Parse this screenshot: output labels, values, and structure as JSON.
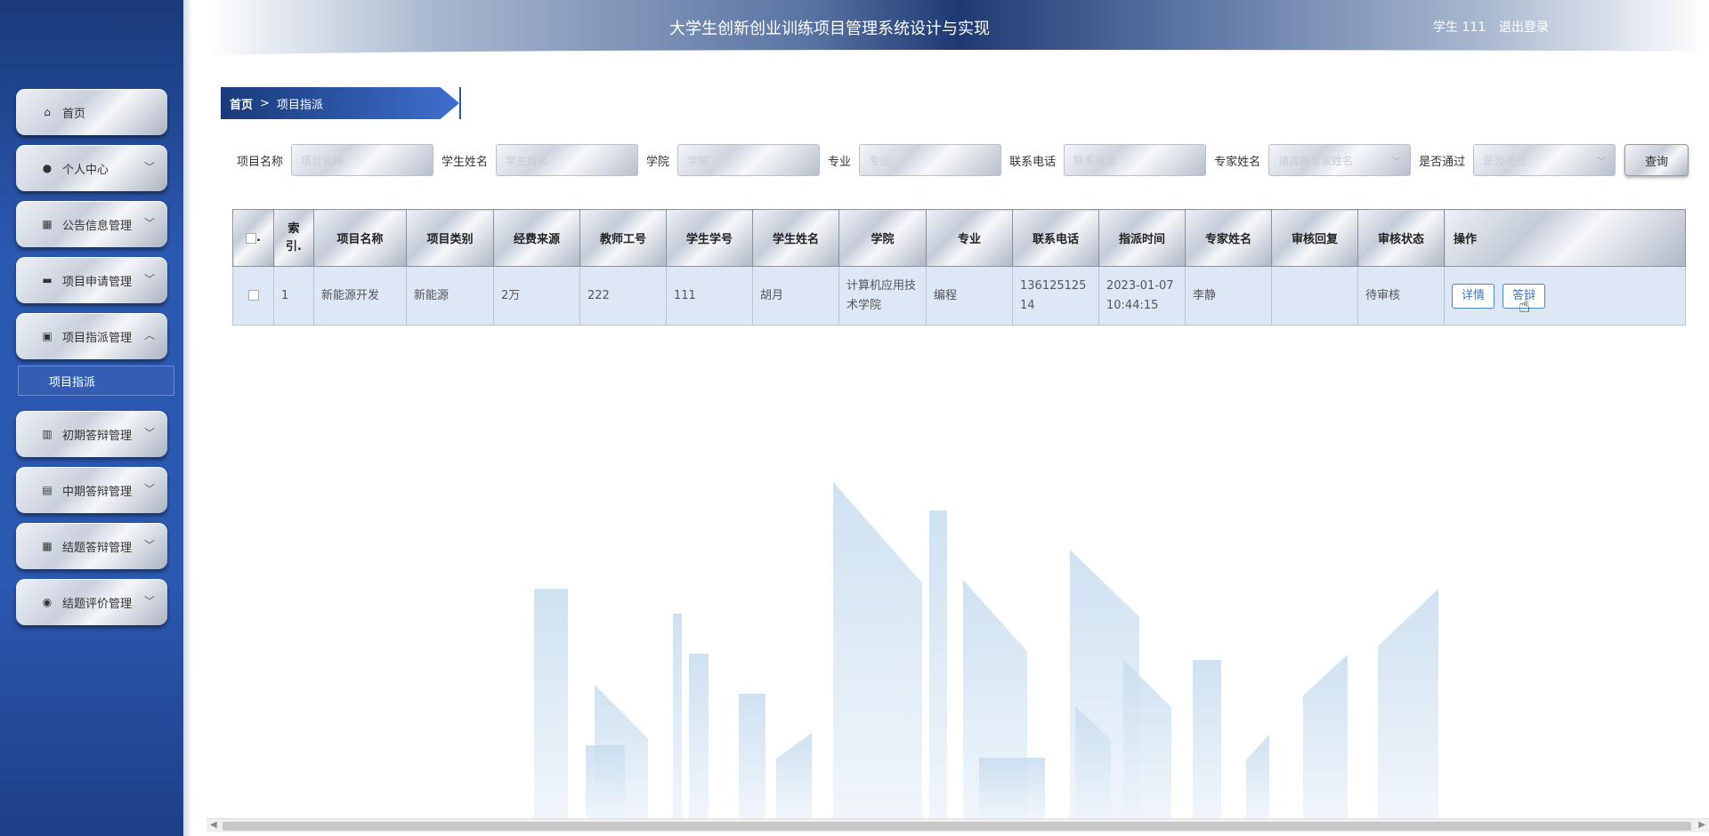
{
  "header": {
    "title": "大学生创新创业训练项目管理系统设计与实现",
    "user": "学生 111",
    "logout": "退出登录"
  },
  "sidebar": {
    "items": [
      {
        "label": "首页",
        "icon": "home-icon",
        "glyph": "⌂",
        "has_chevron": false
      },
      {
        "label": "个人中心",
        "icon": "user-icon",
        "glyph": "●",
        "has_chevron": true,
        "chevron": "﹀"
      },
      {
        "label": "公告信息管理",
        "icon": "grid-icon",
        "glyph": "▦",
        "has_chevron": true,
        "chevron": "﹀"
      },
      {
        "label": "项目申请管理",
        "icon": "briefcase-icon",
        "glyph": "▬",
        "has_chevron": true,
        "chevron": "﹀"
      },
      {
        "label": "项目指派管理",
        "icon": "clipboard-icon",
        "glyph": "▣",
        "has_chevron": true,
        "chevron": "︿"
      },
      {
        "label": "初期答辩管理",
        "icon": "bar-chart-icon",
        "glyph": "▥",
        "has_chevron": true,
        "chevron": "﹀"
      },
      {
        "label": "中期答辩管理",
        "icon": "book-icon",
        "glyph": "▤",
        "has_chevron": true,
        "chevron": "﹀"
      },
      {
        "label": "结题答辩管理",
        "icon": "grid-icon",
        "glyph": "▦",
        "has_chevron": true,
        "chevron": "﹀"
      },
      {
        "label": "结题评价管理",
        "icon": "location-icon",
        "glyph": "◉",
        "has_chevron": true,
        "chevron": "﹀"
      }
    ],
    "submenu": {
      "label": "项目指派"
    }
  },
  "breadcrumb": {
    "home": "首页",
    "separator": ">",
    "current": "项目指派"
  },
  "filters": {
    "project_name": {
      "label": "项目名称",
      "placeholder": "项目名称"
    },
    "student_name": {
      "label": "学生姓名",
      "placeholder": "学生姓名"
    },
    "college": {
      "label": "学院",
      "placeholder": "学院"
    },
    "major": {
      "label": "专业",
      "placeholder": "专业"
    },
    "phone": {
      "label": "联系电话",
      "placeholder": "联系电话"
    },
    "expert_name": {
      "label": "专家姓名",
      "placeholder": "请选择专家姓名"
    },
    "passed": {
      "label": "是否通过",
      "placeholder": "是否通过"
    },
    "search_label": "查询"
  },
  "table": {
    "checkbox_header_suffix": ".",
    "columns": [
      "索\n引.",
      "项目名称",
      "项目类别",
      "经费来源",
      "教师工号",
      "学生学号",
      "学生姓名",
      "学院",
      "专业",
      "联系电话",
      "指派时间",
      "专家姓名",
      "审核回复",
      "审核状态",
      "操作"
    ],
    "rows": [
      {
        "index": "1",
        "project_name": "新能源开发",
        "category": "新能源",
        "funding": "2万",
        "teacher_id": "222",
        "student_id": "111",
        "student_name": "胡月",
        "college": "计算机应用技术学院",
        "major": "编程",
        "phone": "13612512514",
        "assign_time": "2023-01-07 10:44:15",
        "expert": "李静",
        "reply": "",
        "status": "待审核",
        "actions": [
          "详情",
          "答辩"
        ]
      }
    ]
  },
  "colors": {
    "accent": "#2b58b0",
    "header_dark": "#1e3a72",
    "row_bg": "#dde7f6"
  }
}
